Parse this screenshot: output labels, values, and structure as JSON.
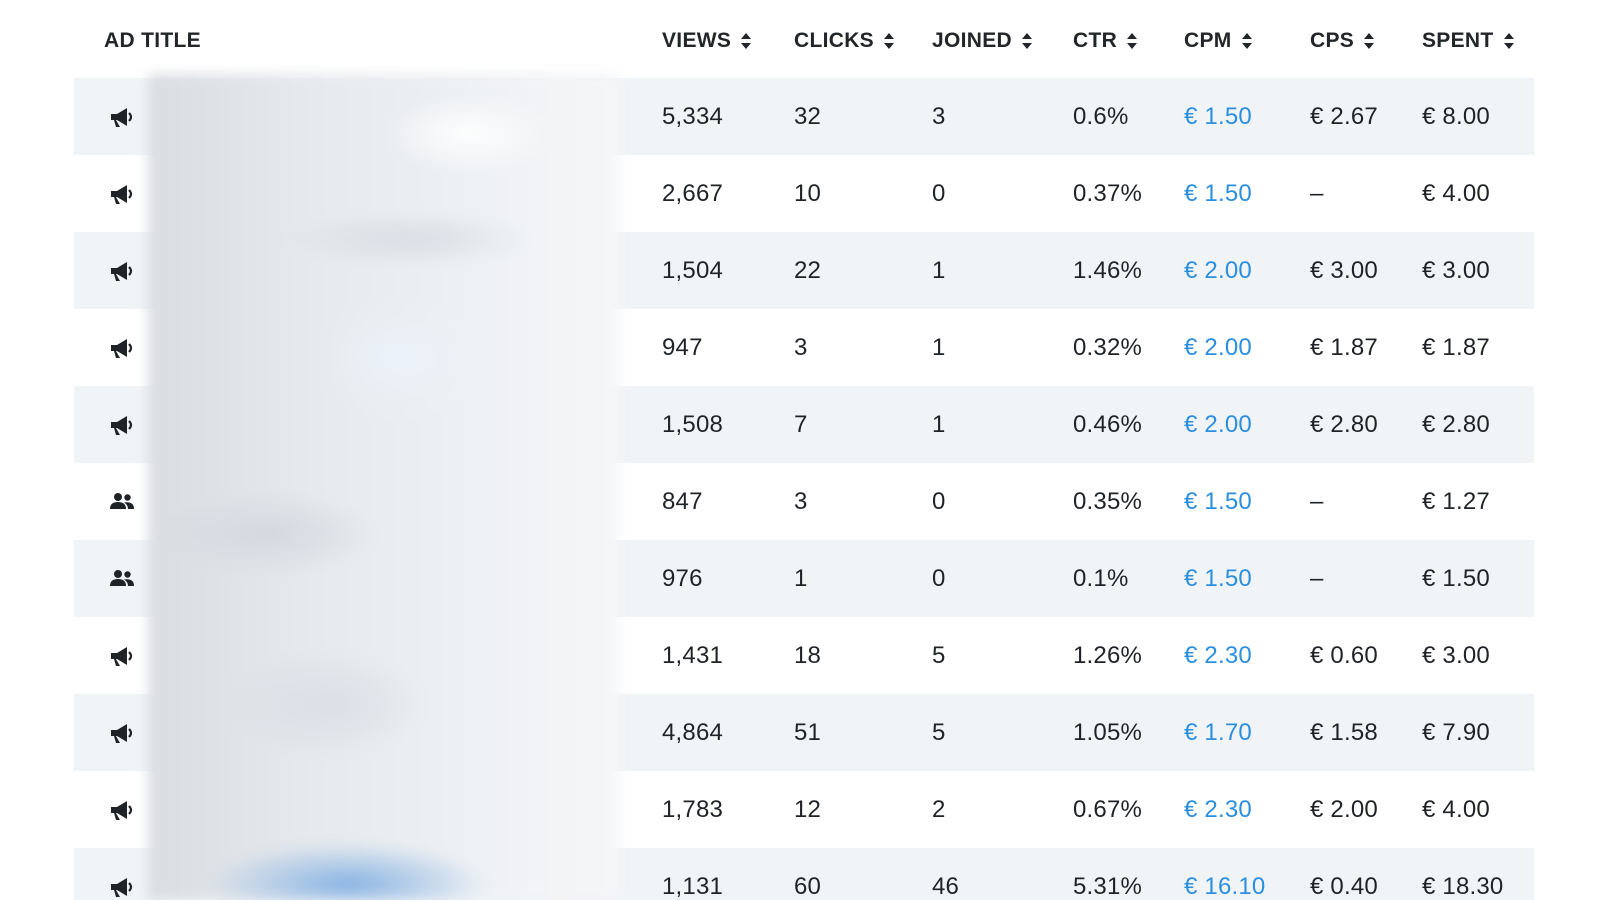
{
  "table": {
    "headers": {
      "title": "AD TITLE",
      "views": "VIEWS",
      "clicks": "CLICKS",
      "joined": "JOINED",
      "ctr": "CTR",
      "cpm": "CPM",
      "cps": "CPS",
      "spent": "SPENT"
    },
    "rows": [
      {
        "icon": "megaphone-icon",
        "views": "5,334",
        "clicks": "32",
        "joined": "3",
        "ctr": "0.6%",
        "cpm": "€ 1.50",
        "cps": "€ 2.67",
        "spent": "€ 8.00"
      },
      {
        "icon": "megaphone-icon",
        "views": "2,667",
        "clicks": "10",
        "joined": "0",
        "ctr": "0.37%",
        "cpm": "€ 1.50",
        "cps": "–",
        "spent": "€ 4.00"
      },
      {
        "icon": "megaphone-icon",
        "views": "1,504",
        "clicks": "22",
        "joined": "1",
        "ctr": "1.46%",
        "cpm": "€ 2.00",
        "cps": "€ 3.00",
        "spent": "€ 3.00"
      },
      {
        "icon": "megaphone-icon",
        "views": "947",
        "clicks": "3",
        "joined": "1",
        "ctr": "0.32%",
        "cpm": "€ 2.00",
        "cps": "€ 1.87",
        "spent": "€ 1.87"
      },
      {
        "icon": "megaphone-icon",
        "views": "1,508",
        "clicks": "7",
        "joined": "1",
        "ctr": "0.46%",
        "cpm": "€ 2.00",
        "cps": "€ 2.80",
        "spent": "€ 2.80"
      },
      {
        "icon": "group-icon",
        "views": "847",
        "clicks": "3",
        "joined": "0",
        "ctr": "0.35%",
        "cpm": "€ 1.50",
        "cps": "–",
        "spent": "€ 1.27"
      },
      {
        "icon": "group-icon",
        "views": "976",
        "clicks": "1",
        "joined": "0",
        "ctr": "0.1%",
        "cpm": "€ 1.50",
        "cps": "–",
        "spent": "€ 1.50"
      },
      {
        "icon": "megaphone-icon",
        "views": "1,431",
        "clicks": "18",
        "joined": "5",
        "ctr": "1.26%",
        "cpm": "€ 2.30",
        "cps": "€ 0.60",
        "spent": "€ 3.00"
      },
      {
        "icon": "megaphone-icon",
        "views": "4,864",
        "clicks": "51",
        "joined": "5",
        "ctr": "1.05%",
        "cpm": "€ 1.70",
        "cps": "€ 1.58",
        "spent": "€ 7.90"
      },
      {
        "icon": "megaphone-icon",
        "views": "1,783",
        "clicks": "12",
        "joined": "2",
        "ctr": "0.67%",
        "cpm": "€ 2.30",
        "cps": "€ 2.00",
        "spent": "€ 4.00"
      },
      {
        "icon": "megaphone-icon",
        "views": "1,131",
        "clicks": "60",
        "joined": "46",
        "ctr": "5.31%",
        "cpm": "€ 16.10",
        "cps": "€ 0.40",
        "spent": "€ 18.30"
      }
    ]
  },
  "colors": {
    "row_alt_background": "#f1f4f7",
    "link": "#2b8fe0",
    "text": "#1f2328"
  }
}
